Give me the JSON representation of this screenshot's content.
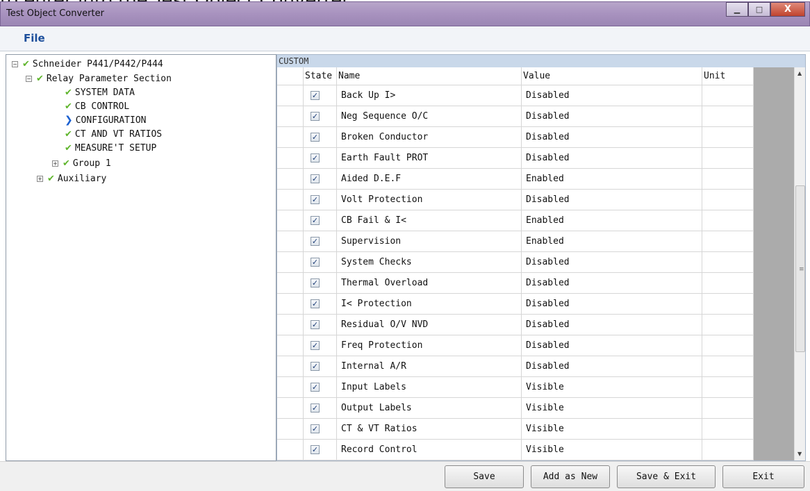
{
  "caption": "to enter into the Test Object Converter.",
  "window": {
    "title": "Test Object Converter",
    "minimize_glyph": "▁",
    "maximize_glyph": "□",
    "close_glyph": "X"
  },
  "menu": {
    "file": "File"
  },
  "tree": {
    "root": "Schneider P441/P442/P444",
    "relay_section": "Relay Parameter Section",
    "items": [
      "SYSTEM DATA",
      "CB CONTROL",
      "CONFIGURATION",
      "CT AND VT RATIOS",
      "MEASURE'T SETUP"
    ],
    "group": "Group 1",
    "auxiliary": "Auxiliary",
    "expanded_glyph": "−",
    "collapsed_glyph": "+",
    "check_glyph": "✔",
    "selected_glyph": "❯"
  },
  "grid": {
    "section_label": "CUSTOM",
    "columns": {
      "state": "State",
      "name": "Name",
      "value": "Value",
      "unit": "Unit"
    },
    "check_glyph": "✓",
    "rows": [
      {
        "name": "Back Up I>",
        "value": "Disabled",
        "unit": ""
      },
      {
        "name": "Neg Sequence O/C",
        "value": "Disabled",
        "unit": ""
      },
      {
        "name": "Broken Conductor",
        "value": "Disabled",
        "unit": ""
      },
      {
        "name": "Earth Fault PROT",
        "value": "Disabled",
        "unit": ""
      },
      {
        "name": "Aided D.E.F",
        "value": "Enabled",
        "unit": ""
      },
      {
        "name": "Volt Protection",
        "value": "Disabled",
        "unit": ""
      },
      {
        "name": "CB Fail & I<",
        "value": "Enabled",
        "unit": ""
      },
      {
        "name": "Supervision",
        "value": "Enabled",
        "unit": ""
      },
      {
        "name": "System Checks",
        "value": "Disabled",
        "unit": ""
      },
      {
        "name": "Thermal Overload",
        "value": "Disabled",
        "unit": ""
      },
      {
        "name": "I< Protection",
        "value": "Disabled",
        "unit": ""
      },
      {
        "name": "Residual O/V NVD",
        "value": "Disabled",
        "unit": ""
      },
      {
        "name": "Freq Protection",
        "value": "Disabled",
        "unit": ""
      },
      {
        "name": "Internal A/R",
        "value": "Disabled",
        "unit": ""
      },
      {
        "name": "Input Labels",
        "value": "Visible",
        "unit": ""
      },
      {
        "name": "Output Labels",
        "value": "Visible",
        "unit": ""
      },
      {
        "name": "CT & VT Ratios",
        "value": "Visible",
        "unit": ""
      },
      {
        "name": "Record Control",
        "value": "Visible",
        "unit": ""
      }
    ]
  },
  "scrollbar": {
    "up_glyph": "▲",
    "down_glyph": "▼",
    "grip_glyph": "≡"
  },
  "buttons": {
    "save": "Save",
    "add_as_new": "Add as New",
    "save_exit": "Save & Exit",
    "exit": "Exit"
  }
}
